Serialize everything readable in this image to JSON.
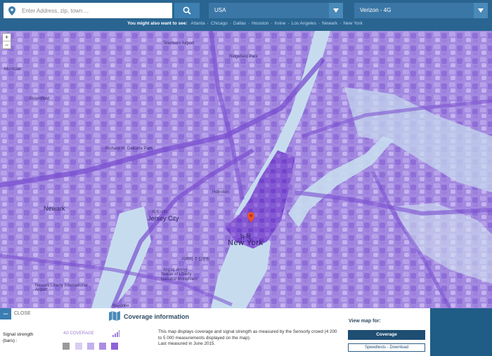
{
  "search": {
    "placeholder": "Enter Address, zip, town ..."
  },
  "selects": {
    "country": "USA",
    "network": "Verizon - 4G"
  },
  "suggest": {
    "lead": "You might also want to see:",
    "cities": [
      "Atlanta",
      "Chicago",
      "Dallas",
      "Houston",
      "Irvine",
      "Los Angeles",
      "Newark",
      "New York"
    ]
  },
  "map": {
    "zoom_in": "+",
    "zoom_out": "−",
    "labels": {
      "montclair": "Montclair",
      "bloomfield": "Bloomfield",
      "newark": "Newark",
      "jersey_city_kr": "저지시티",
      "jersey_city": "Jersey City",
      "hoboken": "Hoboken",
      "new_york_kr": "뉴욕",
      "new_york": "New York",
      "liberty_park": "리버티 주립공원",
      "statue_kr": "자유의 여신상",
      "statue_en1": "Statue of Liberty",
      "statue_en2": "National Monument",
      "newark_airport": "Newark Liberty International Airport",
      "teterboro": "Teterboro Airport",
      "ridgefield": "Ridgefield Park",
      "richard_park": "Richard W. DeKorte Park",
      "bayonne": "Bayonne"
    }
  },
  "panel": {
    "close_label": "CLOSE",
    "title": "Coverage information",
    "signal_label": "Signal strength (bars) :",
    "coverage_type": "4G COVERAGE",
    "info_line1": "This map displays coverage and signal strength as measured by the Sensorly crowd (4 200 to 5 000 measurements displayed on the map).",
    "info_line2": "Last measured in June 2015.",
    "view_title": "View map for:",
    "coverage_button": "Coverage",
    "speedtest_button": "Speedtests - Download",
    "swatch_colors": [
      "#9a9a9a",
      "#d9cdf2",
      "#c3b0ec",
      "#aa8ce3",
      "#8e63d8"
    ]
  },
  "colors": {
    "topbar": "#2a6591",
    "coverage_purple": "#9c7fdc",
    "coverage_dark": "#7a4fd0",
    "water": "#c6dcee",
    "marker": "#e8512d"
  }
}
